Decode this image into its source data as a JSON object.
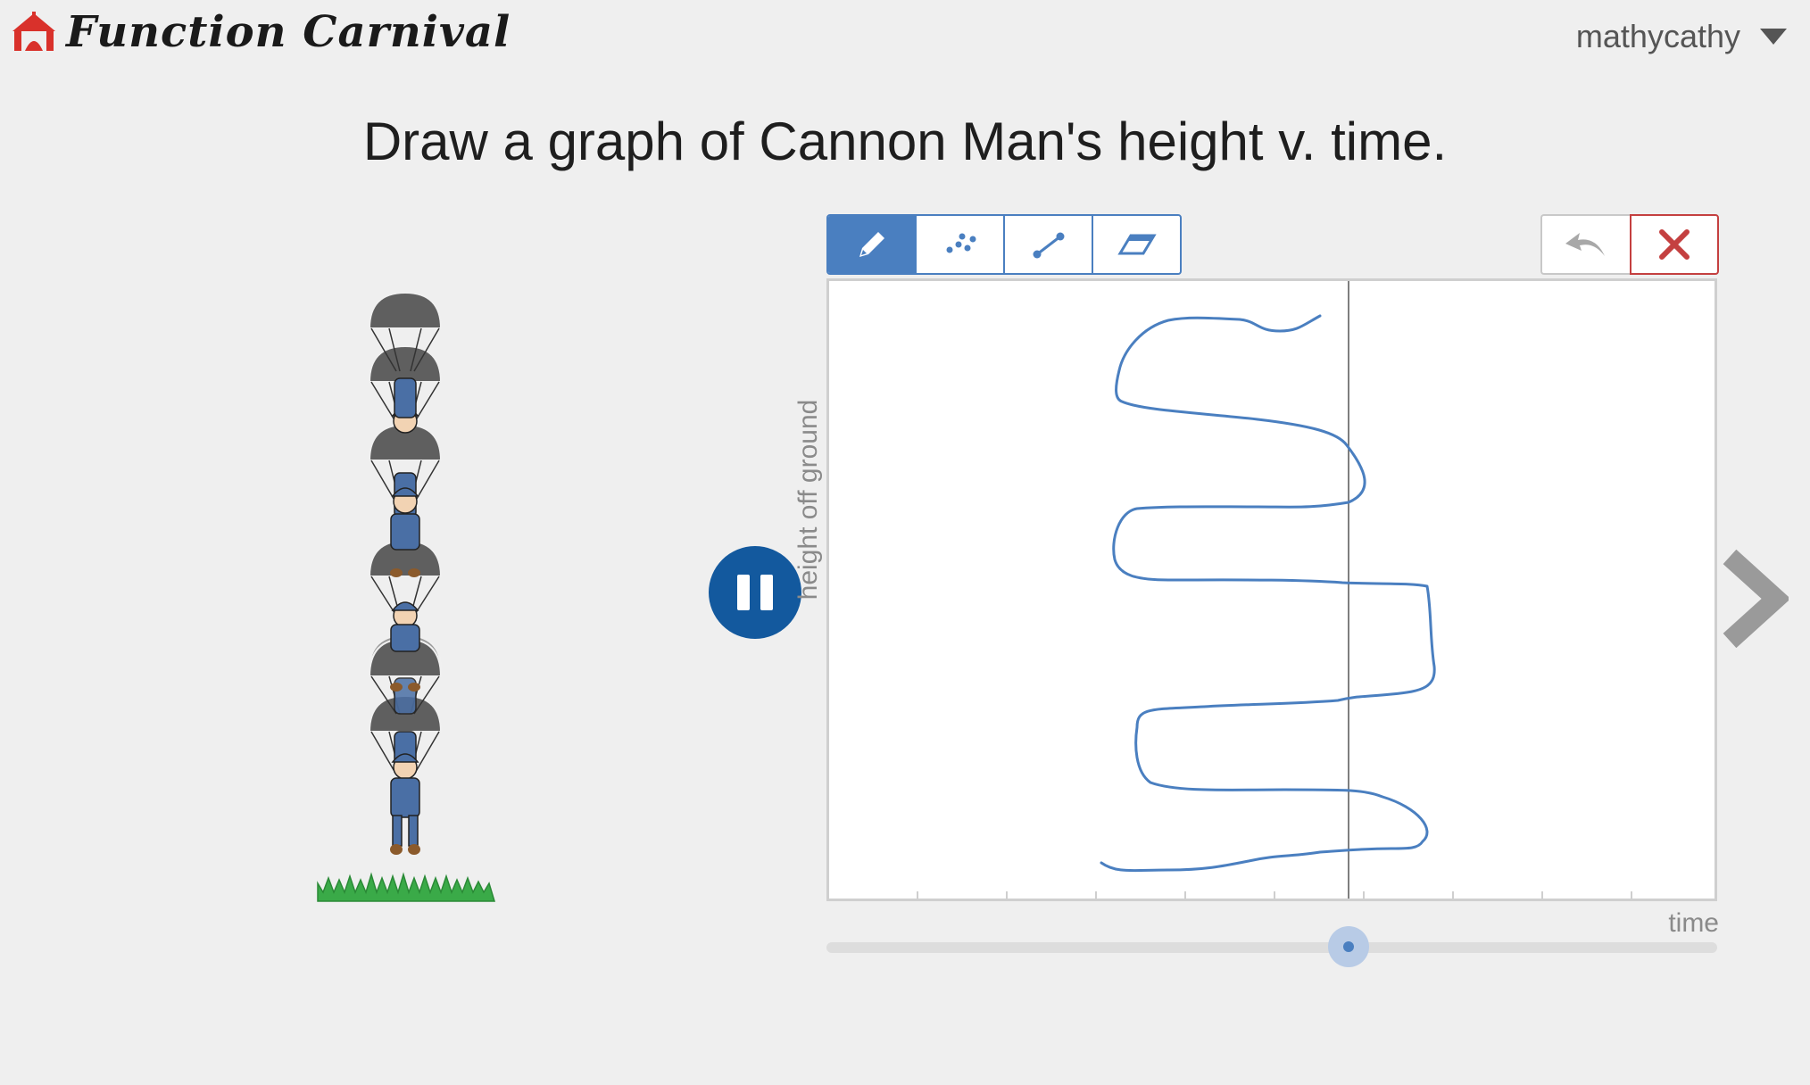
{
  "app": {
    "title": "Function Carnival"
  },
  "user": {
    "name": "mathycathy"
  },
  "prompt": "Draw a graph of Cannon Man's height v. time.",
  "graph": {
    "ylabel": "height off ground",
    "xlabel": "time"
  },
  "tools": [
    {
      "icon": "pencil-icon",
      "active": true
    },
    {
      "icon": "points-icon",
      "active": false
    },
    {
      "icon": "line-icon",
      "active": false
    },
    {
      "icon": "eraser-icon",
      "active": false
    }
  ],
  "colors": {
    "accent": "#4a7fc0",
    "pause": "#13599e",
    "clear": "#c44040",
    "curve": "#4a7fc0"
  },
  "playback": {
    "state": "playing",
    "time_position": 0.585
  }
}
